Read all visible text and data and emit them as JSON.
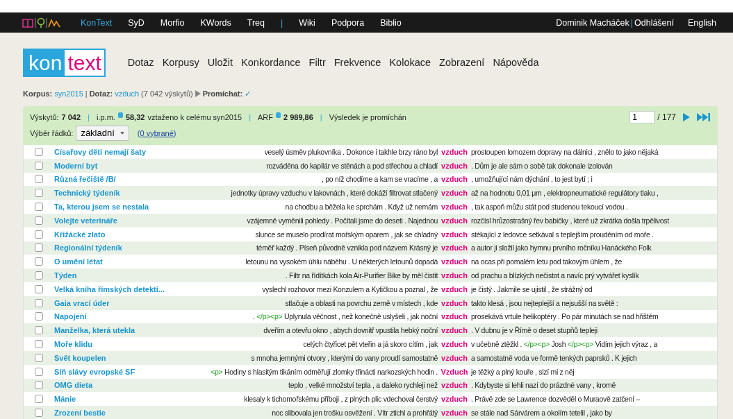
{
  "topbar": {
    "apps": [
      {
        "label": "KonText",
        "selected": true
      },
      {
        "label": "SyD",
        "selected": false
      },
      {
        "label": "Morfio",
        "selected": false
      },
      {
        "label": "KWords",
        "selected": false
      },
      {
        "label": "Treq",
        "selected": false
      }
    ],
    "separator": "|",
    "links": [
      "Wiki",
      "Podpora",
      "Biblio"
    ],
    "user": "Dominik Macháček",
    "logout": "Odhlášení",
    "language": "English"
  },
  "logo": {
    "left": "kon",
    "right": "text"
  },
  "menu": [
    "Dotaz",
    "Korpusy",
    "Uložit",
    "Konkordance",
    "Filtr",
    "Frekvence",
    "Kolokace",
    "Zobrazení",
    "Nápověda"
  ],
  "breadcrumb": {
    "corpus_label": "Korpus:",
    "corpus": "syn2015",
    "query_label": "Dotaz:",
    "query": "vzduch",
    "hits": "(7 042 výskytů)",
    "shuffle_label": "Promíchat:",
    "shuffle": "✓"
  },
  "summary": {
    "hits_label": "Výskytů:",
    "hits": "7 042",
    "ipm_label": "i.p.m.",
    "ipm": "58,32",
    "ipm_note": "vztaženo k celému syn2015",
    "arf_label": "ARF",
    "arf": "2 989,86",
    "shuffled": "Výsledek je promíchán",
    "page": "1",
    "pages": "/ 177",
    "select_label": "Výběr řádků:",
    "select_value": "základní",
    "selected_count": "(0 vybrané)"
  },
  "rows": [
    {
      "checked": false,
      "title": "Císařovy děti nemají šaty",
      "left": [
        {
          "kind": "word",
          "text": "veselý úsměv plukovníka . Dokonce i takhle brzy ráno byl"
        }
      ],
      "kwic": "vzduch",
      "right": [
        {
          "kind": "word",
          "text": "prostoupen lomozem dopravy na dálnici , znělo to jako nějaká"
        }
      ]
    },
    {
      "checked": false,
      "title": "Moderní byt",
      "left": [
        {
          "kind": "word",
          "text": "rozváděna do kapilár ve stěnách a pod střechou a chladí"
        }
      ],
      "kwic": "vzduch",
      "right": [
        {
          "kind": "word",
          "text": ". Dům je ale sám o sobě tak dokonale izolován"
        }
      ]
    },
    {
      "checked": false,
      "title": "Různá řečiště /B/",
      "left": [
        {
          "kind": "word",
          "text": ", po níž chodíme a kam se vracíme , a"
        }
      ],
      "kwic": "vzduch",
      "right": [
        {
          "kind": "word",
          "text": ", umožňující nám dýchání , to jest bytí ; i"
        }
      ]
    },
    {
      "checked": false,
      "title": "Technický týdeník",
      "left": [
        {
          "kind": "word",
          "text": "jednotky úpravy vzduchu v lakovnách , které dokáží filtrovat stlačený"
        }
      ],
      "kwic": "vzduch",
      "right": [
        {
          "kind": "word",
          "text": "až na hodnotu 0,01 μm , elektropneumatické regulátory tlaku ,"
        }
      ]
    },
    {
      "checked": false,
      "title": "Ta, kterou jsem se nestala",
      "left": [
        {
          "kind": "word",
          "text": "na chodbu a běžela ke sprchám . Když už nemám"
        }
      ],
      "kwic": "vzduch",
      "right": [
        {
          "kind": "word",
          "text": ", tak aspoň můžu stát pod studenou tekoucí vodou ."
        }
      ]
    },
    {
      "checked": false,
      "title": "Volejte veterináře",
      "left": [
        {
          "kind": "word",
          "text": "vzájemně vyměnili pohledy . Počítali jsme do deseti . Najednou"
        }
      ],
      "kwic": "vzduch",
      "right": [
        {
          "kind": "word",
          "text": "rozčísl hrůzostrašný řev babičky , které už zkrátka došla trpělivost"
        }
      ]
    },
    {
      "checked": false,
      "title": "Křižácké zlato",
      "left": [
        {
          "kind": "word",
          "text": "slunce se muselo prodírat mořským oparem , jak se chladný"
        }
      ],
      "kwic": "vzduch",
      "right": [
        {
          "kind": "word",
          "text": "stékající z ledovce setkával s teplejším prouděním od moře ."
        }
      ]
    },
    {
      "checked": false,
      "title": "Regionální týdeník",
      "left": [
        {
          "kind": "word",
          "text": "téměř každý . Píseň původně vznikla pod názvem Krásný je"
        }
      ],
      "kwic": "vzduch",
      "right": [
        {
          "kind": "word",
          "text": "a autor ji složil jako hymnu prvního ročníku Hanáckého Folk"
        }
      ]
    },
    {
      "checked": false,
      "title": "O umění létat",
      "left": [
        {
          "kind": "word",
          "text": "letounu na vysokém úhlu náběhu . U některých letounů dopadá"
        }
      ],
      "kwic": "vzduch",
      "right": [
        {
          "kind": "word",
          "text": "na ocas při pomalém letu pod takovým úhlem , že"
        }
      ]
    },
    {
      "checked": false,
      "title": "Týden",
      "left": [
        {
          "kind": "word",
          "text": ". Filtr na řídítkách kola Air-Purifier Bike by měl čistit"
        }
      ],
      "kwic": "vzduch",
      "right": [
        {
          "kind": "word",
          "text": "od prachu a blízkých nečistot a navíc prý vytvářet kyslík"
        }
      ]
    },
    {
      "checked": false,
      "title": "Velká kniha římských detekti...",
      "left": [
        {
          "kind": "word",
          "text": "vyslechl rozhovor mezi Konzulem a Kytičkou a poznal , že"
        }
      ],
      "kwic": "vzduch",
      "right": [
        {
          "kind": "word",
          "text": "je čistý . Jakmile se ujistil , že strážný od"
        }
      ]
    },
    {
      "checked": false,
      "title": "Gaia vrací úder",
      "left": [
        {
          "kind": "word",
          "text": "stlačuje a oblasti na povrchu země v místech , kde"
        }
      ],
      "kwic": "vzduch",
      "right": [
        {
          "kind": "word",
          "text": "takto klesá , jsou nejteplejší a nejsušší na světě :"
        }
      ]
    },
    {
      "checked": false,
      "title": "Napojení",
      "left": [
        {
          "kind": "word",
          "text": ". "
        },
        {
          "kind": "tag",
          "text": "</p><p>"
        },
        {
          "kind": "word",
          "text": " Uplynula věčnost , než konečně uslyšeli , jak noční"
        }
      ],
      "kwic": "vzduch",
      "right": [
        {
          "kind": "word",
          "text": "prosekává vrtule helikoptéry . Po pár minutách se nad hřištěm"
        }
      ]
    },
    {
      "checked": false,
      "title": "Manželka, která utekla",
      "left": [
        {
          "kind": "word",
          "text": "dveřím a otevřu okno , abych dovnitř vpustila hebký noční"
        }
      ],
      "kwic": "vzduch",
      "right": [
        {
          "kind": "word",
          "text": ". V dubnu je v Římě o deset stupňů tepleji"
        }
      ]
    },
    {
      "checked": false,
      "title": "Moře klidu",
      "left": [
        {
          "kind": "word",
          "text": "celých čtyřicet pět vteřin a já skoro cítím , jak"
        }
      ],
      "kwic": "vzduch",
      "right": [
        {
          "kind": "word",
          "text": "v učebně ztěžkl . "
        },
        {
          "kind": "tag",
          "text": "</p><p>"
        },
        {
          "kind": "word",
          "text": " Josh "
        },
        {
          "kind": "tag",
          "text": "</p><p>"
        },
        {
          "kind": "word",
          "text": " Vidím jejich výraz , a"
        }
      ]
    },
    {
      "checked": false,
      "title": "Svět koupelen",
      "left": [
        {
          "kind": "word",
          "text": "s mnoha jemnými otvory , kterými do vany proudí samostatně"
        }
      ],
      "kwic": "vzduch",
      "right": [
        {
          "kind": "word",
          "text": "a samostatně voda ve formě tenkých paprsků . K jejich"
        }
      ]
    },
    {
      "checked": false,
      "title": "Síň slávy evropské SF",
      "left": [
        {
          "kind": "tag",
          "text": "<p>"
        },
        {
          "kind": "word",
          "text": " Hodiny s hlasitým tikáním odměřují zlomky třinácti narkozských hodin ."
        }
      ],
      "kwic": "Vzduch",
      "right": [
        {
          "kind": "word",
          "text": "je těžký a plný kouře , slzí mi z něj"
        }
      ]
    },
    {
      "checked": false,
      "title": "OMG dieta",
      "left": [
        {
          "kind": "word",
          "text": "teplo , velké množství tepla , a daleko rychleji než"
        }
      ],
      "kwic": "vzduch",
      "right": [
        {
          "kind": "word",
          "text": ". Kdybyste si lehli nazí do prázdné vany , kromě"
        }
      ]
    },
    {
      "checked": false,
      "title": "Mánie",
      "left": [
        {
          "kind": "word",
          "text": "klesaly k tichomořskému příboji , z plných plic vdechoval čerstvý"
        }
      ],
      "kwic": "vzduch",
      "right": [
        {
          "kind": "word",
          "text": ". Právě zde se Lawrence dozvěděl o Muraově zatčení –"
        }
      ]
    },
    {
      "checked": false,
      "title": "Zrození bestie",
      "left": [
        {
          "kind": "word",
          "text": "noc slibovala jen trošku osvěžení . Vítr ztichl a prohřátý"
        }
      ],
      "kwic": "vzduch",
      "right": [
        {
          "kind": "word",
          "text": "se stále nad Sárvárem a okolím tetelil , jako by"
        }
      ]
    }
  ]
}
